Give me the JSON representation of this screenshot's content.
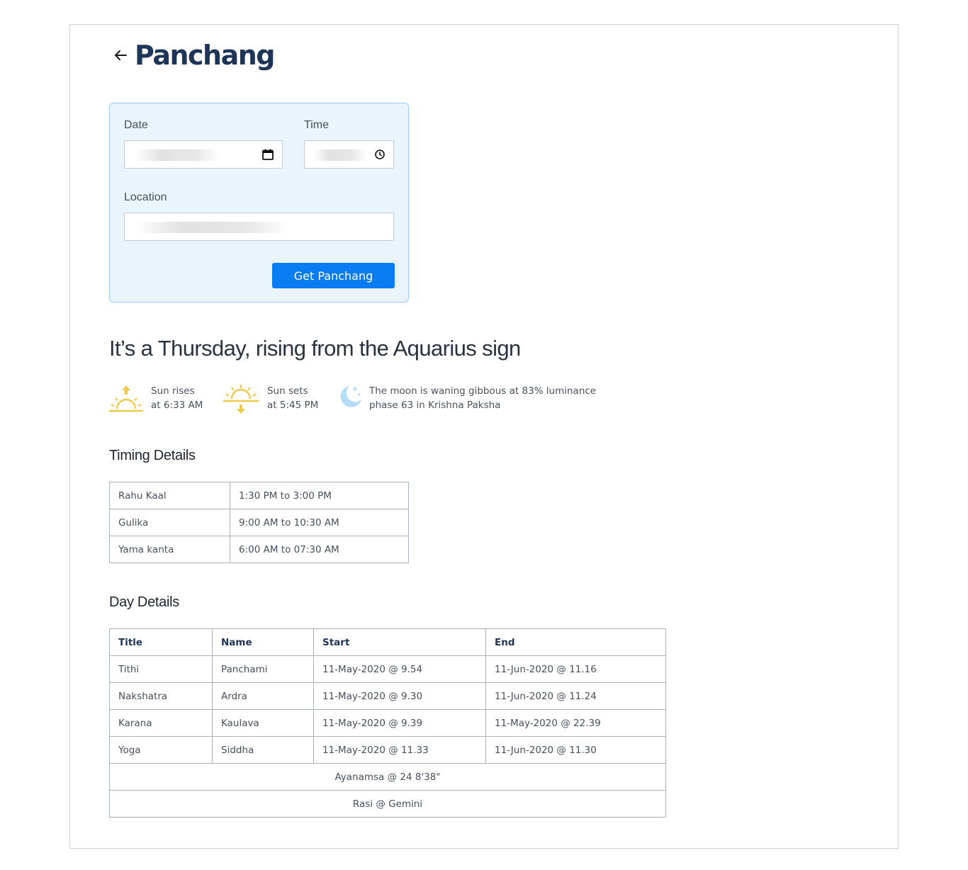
{
  "header": {
    "title": "Panchang",
    "back_icon": "arrow-left-icon"
  },
  "form": {
    "date_label": "Date",
    "time_label": "Time",
    "location_label": "Location",
    "submit_label": "Get Panchang"
  },
  "summary": {
    "headline": "It’s a Thursday, rising from the Aquarius sign"
  },
  "astro": {
    "sunrise": {
      "line1": "Sun rises",
      "line2": "at 6:33 AM",
      "icon": "sunrise-icon"
    },
    "sunset": {
      "line1": "Sun sets",
      "line2": "at 5:45 PM",
      "icon": "sunset-icon"
    },
    "moon": {
      "line1": "The moon is waning gibbous at 83% luminance",
      "line2": "phase 63 in Krishna Paksha",
      "icon": "moon-icon"
    }
  },
  "timing": {
    "title": "Timing Details",
    "rows": [
      {
        "name": "Rahu Kaal",
        "value": "1:30 PM to 3:00 PM"
      },
      {
        "name": "Gulika",
        "value": "9:00 AM to 10:30 AM"
      },
      {
        "name": "Yama kanta",
        "value": "6:00 AM to 07:30 AM"
      }
    ]
  },
  "day": {
    "title": "Day Details",
    "headers": [
      "Title",
      "Name",
      "Start",
      "End"
    ],
    "rows": [
      [
        "Tithi",
        "Panchami",
        "11-May-2020 @ 9.54",
        "11-Jun-2020 @ 11.16"
      ],
      [
        "Nakshatra",
        "Ardra",
        "11-May-2020 @ 9.30",
        "11-Jun-2020 @ 11.24"
      ],
      [
        "Karana",
        "Kaulava",
        "11-May-2020 @ 9.39",
        "11-May-2020 @ 22.39"
      ],
      [
        "Yoga",
        "Siddha",
        "11-May-2020 @ 11.33",
        "11-Jun-2020 @ 11.30"
      ]
    ],
    "ayanamsa": "Ayanamsa @ 24 8'38\"",
    "rasi": "Rasi @ Gemini"
  },
  "colors": {
    "accent": "#0a7cf2",
    "title": "#1f3557",
    "sun": "#f2c84b",
    "moon": "#b3dcf7",
    "card_bg": "#eaf4fd"
  }
}
